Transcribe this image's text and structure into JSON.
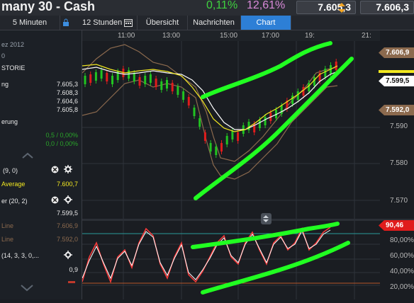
{
  "window": {
    "title": "many 30 - Cash",
    "change_pct": "0,11%",
    "change_pct2": "12,61%",
    "bid": "7.605,3",
    "ask": "7.606,3"
  },
  "tabs": [
    {
      "label": "5 Minuten"
    },
    {
      "label": "12 Stunden"
    },
    {
      "label": "Übersicht"
    },
    {
      "label": "Nachrichten"
    },
    {
      "label": "Chart"
    }
  ],
  "sidebar": {
    "date": "ez 2012",
    "zero": "0",
    "history": "STORIE",
    "quotes": [
      {
        "label": "ng",
        "value": "7.605,3"
      },
      {
        "label": "",
        "value": "7.608,3"
      },
      {
        "label": "",
        "value": "7.604,6"
      },
      {
        "label": "",
        "value": "7.605,8"
      }
    ],
    "erung": "erung",
    "perf": [
      {
        "value": "0,5 / 0,00%"
      },
      {
        "value": "0,0 / 0,00%"
      }
    ],
    "indicators": [
      {
        "name": "(9, 0)"
      },
      {
        "name": "Average",
        "value": "7.600,7"
      },
      {
        "name": "er (20, 2)",
        "value": "7.599,5"
      },
      {
        "name": "Line",
        "value": "7.606,9"
      },
      {
        "name": "Line",
        "value": "7.592,0"
      },
      {
        "name": "(14, 3, 3, 0,..."
      },
      {
        "name": "",
        "value": "0,9"
      }
    ]
  },
  "chart": {
    "time_labels": [
      "11:00",
      "13:00",
      "15:00",
      "17:00",
      "19:",
      "21:"
    ],
    "price_labels": [
      "7.590",
      "7.580",
      "7.570"
    ],
    "tags": {
      "upper": "7.606,9",
      "current": "7.599,5",
      "lower": "7.592,0",
      "osc": "90,46"
    },
    "osc_labels": [
      "80,00%",
      "60,00%",
      "40,00%",
      "20,00%"
    ],
    "colors": {
      "green": "#21ff21",
      "red": "#e01c1c",
      "yellow": "#f2e820",
      "brown": "#8c6a4e"
    }
  }
}
